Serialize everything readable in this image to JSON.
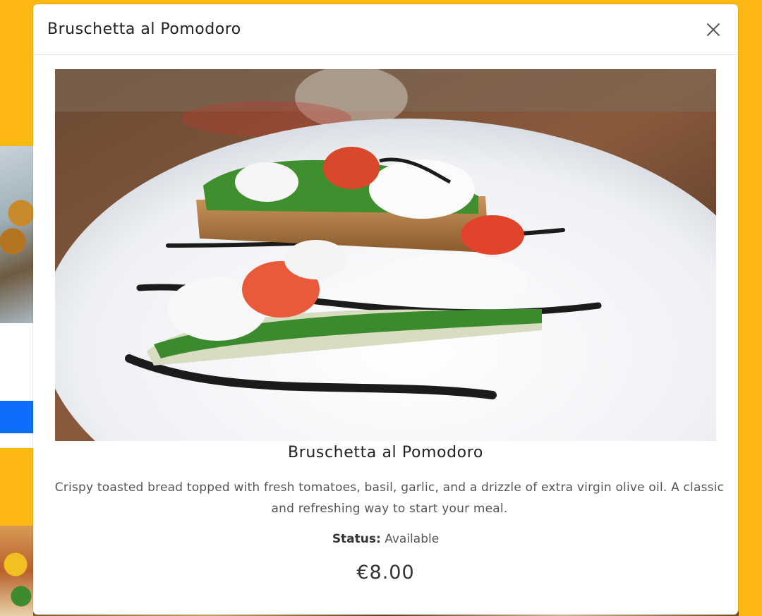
{
  "modal": {
    "title": "Bruschetta al Pomodoro",
    "close_icon": "close-icon"
  },
  "item": {
    "name": "Bruschetta al Pomodoro",
    "image_alt": "Bruschetta al Pomodoro",
    "description": "Crispy toasted bread topped with fresh tomatoes, basil, garlic, and a drizzle of extra virgin olive oil. A classic and refreshing way to start your meal.",
    "status_label": "Status:",
    "status_value": "Available",
    "price": "€8.00"
  },
  "colors": {
    "page_background": "#FDB813",
    "background_button": "#0d6efd",
    "modal_background": "#ffffff"
  }
}
